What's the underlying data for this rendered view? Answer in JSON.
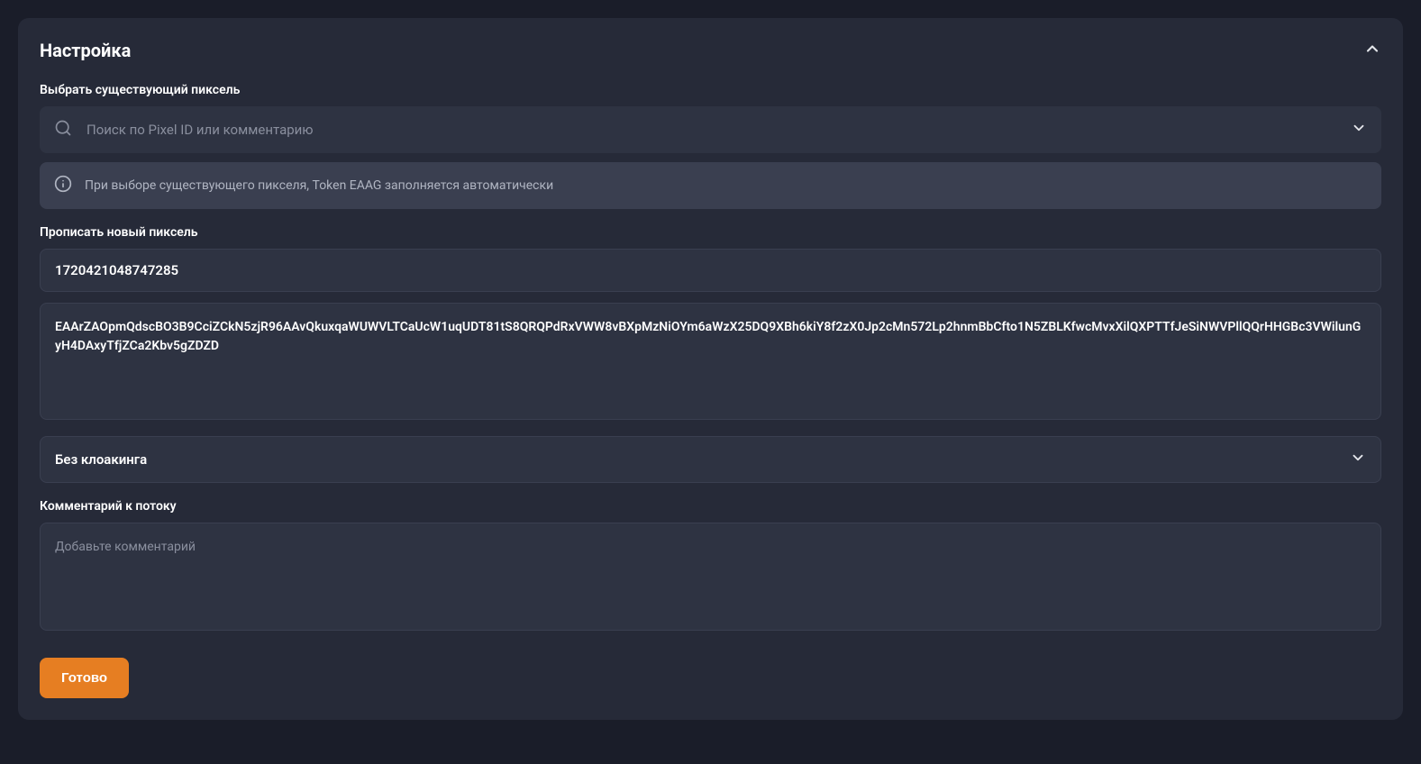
{
  "panel": {
    "title": "Настройка"
  },
  "pixel_select": {
    "label": "Выбрать существующий пиксель",
    "placeholder": "Поиск по Pixel ID или комментарию",
    "info_text": "При выборе существующего пикселя, Token EAAG заполняется автоматически"
  },
  "new_pixel": {
    "label": "Прописать новый пиксель",
    "pixel_id": "1720421048747285",
    "token": "EAArZAOpmQdscBO3B9CciZCkN5zjR96AAvQkuxqaWUWVLTCaUcW1uqUDT81tS8QRQPdRxVWW8vBXpMzNiOYm6aWzX25DQ9XBh6kiY8f2zX0Jp2cMn572Lp2hnmBbCfto1N5ZBLKfwcMvxXilQXPTTfJeSiNWVPllQQrHHGBc3VWilunGyH4DAxyTfjZCa2Kbv5gZDZD"
  },
  "cloaking": {
    "selected": "Без клоакинга"
  },
  "comment": {
    "label": "Комментарий к потоку",
    "placeholder": "Добавьте комментарий"
  },
  "submit": {
    "label": "Готово"
  }
}
